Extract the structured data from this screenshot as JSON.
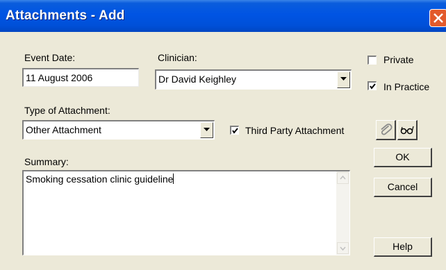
{
  "window": {
    "title": "Attachments - Add",
    "close_icon": "close-icon"
  },
  "event_date": {
    "label": "Event Date:",
    "value": "11 August 2006"
  },
  "clinician": {
    "label": "Clinician:",
    "value": "Dr David Keighley"
  },
  "private": {
    "label": "Private",
    "checked": false
  },
  "in_practice": {
    "label": "In Practice",
    "checked": true
  },
  "type_of_attachment": {
    "label": "Type of Attachment:",
    "value": "Other Attachment"
  },
  "third_party": {
    "label": "Third Party Attachment",
    "checked": true
  },
  "toolbar": {
    "attach_icon": "paperclip-icon",
    "view_icon": "glasses-icon"
  },
  "summary": {
    "label": "Summary:",
    "value": "Smoking cessation clinic guideline"
  },
  "buttons": {
    "ok": "OK",
    "cancel": "Cancel",
    "help": "Help"
  }
}
